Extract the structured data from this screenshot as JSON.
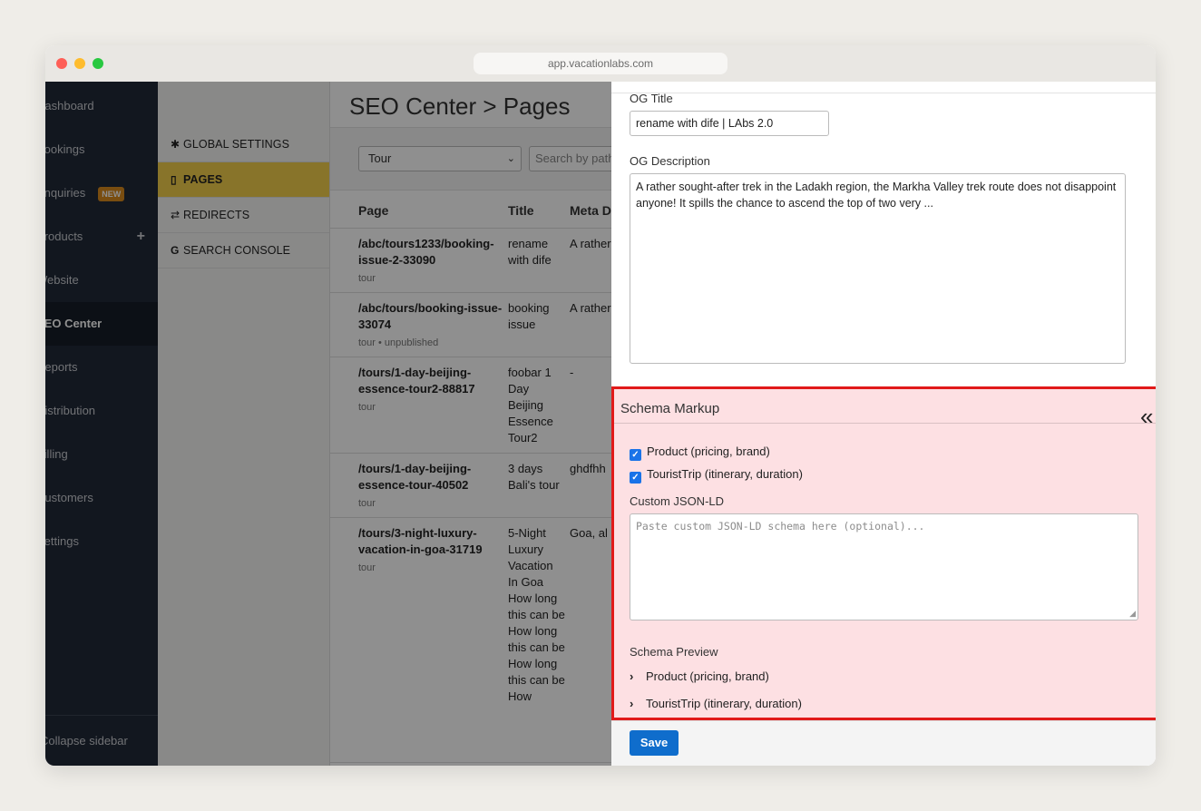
{
  "browser": {
    "url": "app.vacationlabs.com"
  },
  "sidebar": {
    "items": [
      {
        "label": "Dashboard"
      },
      {
        "label": "Bookings"
      },
      {
        "label": "Enquiries",
        "badge": "NEW"
      },
      {
        "label": "Products"
      },
      {
        "label": "Website"
      },
      {
        "label": "SEO Center"
      },
      {
        "label": "Reports"
      },
      {
        "label": "Distribution"
      },
      {
        "label": "Billing"
      },
      {
        "label": "Customers"
      },
      {
        "label": "Settings"
      }
    ],
    "collapse_label": "Collapse sidebar"
  },
  "subnav": {
    "items": [
      {
        "label": "GLOBAL SETTINGS",
        "icon": "gear-icon"
      },
      {
        "label": "PAGES",
        "icon": "document-icon"
      },
      {
        "label": "REDIRECTS",
        "icon": "exchange-icon"
      },
      {
        "label": "SEARCH CONSOLE",
        "icon": "google-icon"
      }
    ]
  },
  "main": {
    "title": "SEO Center > Pages",
    "filter_value": "Tour",
    "search_placeholder": "Search by path",
    "columns": [
      "Page",
      "Title",
      "Meta D"
    ],
    "rows": [
      {
        "page": "/abc/tours1233/booking-issue-2-33090",
        "meta": "tour",
        "title": "rename with dife",
        "desc": "A rather"
      },
      {
        "page": "/abc/tours/booking-issue-33074",
        "meta": "tour • unpublished",
        "title": "booking issue",
        "desc": "A rather"
      },
      {
        "page": "/tours/1-day-beijing-essence-tour2-88817",
        "meta": "tour",
        "title": "foobar 1 Day Beijing Essence Tour2",
        "desc": "-"
      },
      {
        "page": "/tours/1-day-beijing-essence-tour-40502",
        "meta": "tour",
        "title": "3 days Bali's tour",
        "desc": "ghdfhh"
      },
      {
        "page": "/tours/3-night-luxury-vacation-in-goa-31719",
        "meta": "tour",
        "title": "5-Night Luxury Vacation In Goa How long this can be How long this can be How long this can be How",
        "desc": "Goa, al"
      }
    ]
  },
  "panel": {
    "og_title_label": "OG Title",
    "og_title_value": "rename with dife | LAbs 2.0",
    "og_desc_label": "OG Description",
    "og_desc_value": "A rather sought-after trek in the Ladakh region, the Markha Valley trek route does not disappoint anyone! It spills the chance to ascend the top of two very ...",
    "schema": {
      "title": "Schema Markup",
      "options": [
        {
          "label": "Product (pricing, brand)",
          "checked": true
        },
        {
          "label": "TouristTrip (itinerary, duration)",
          "checked": true
        }
      ],
      "custom_label": "Custom JSON-LD",
      "custom_placeholder": "Paste custom JSON-LD schema here (optional)...",
      "preview_label": "Schema Preview",
      "preview_items": [
        "Product (pricing, brand)",
        "TouristTrip (itinerary, duration)"
      ]
    },
    "save_label": "Save"
  }
}
